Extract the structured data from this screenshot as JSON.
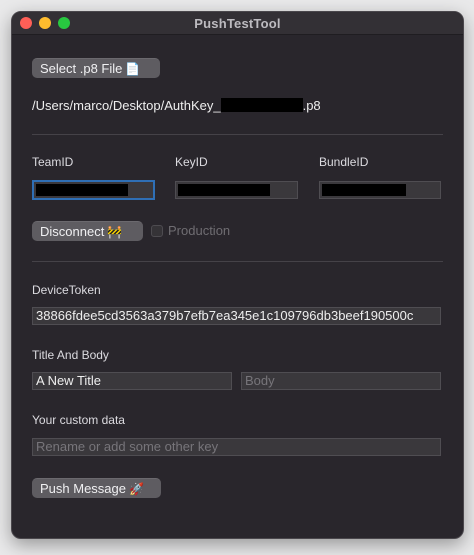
{
  "window": {
    "title": "PushTestTool"
  },
  "file": {
    "select_label": "Select .p8 File",
    "select_emoji": "📄",
    "path_prefix": "/Users/marco/Desktop/AuthKey_",
    "path_suffix": ".p8"
  },
  "credentials": {
    "team_label": "TeamID",
    "key_label": "KeyID",
    "bundle_label": "BundleID"
  },
  "connection": {
    "disconnect_label": "Disconnect",
    "disconnect_emoji": "🚧",
    "production_label": "Production",
    "production_checked": false
  },
  "device": {
    "label": "DeviceToken",
    "token": "38866fdee5cd3563a379b7efb7ea345e1c109796db3beef190500c"
  },
  "message": {
    "section_label": "Title And Body",
    "title_value": "A New Title",
    "body_placeholder": "Body"
  },
  "custom": {
    "label": "Your custom data",
    "placeholder": "Rename or add some other key"
  },
  "push": {
    "label": "Push Message",
    "emoji": "🚀"
  },
  "colors": {
    "window_bg": "#29262c",
    "focus_ring": "#2f6fb5",
    "button_bg": "#5e5c61"
  }
}
